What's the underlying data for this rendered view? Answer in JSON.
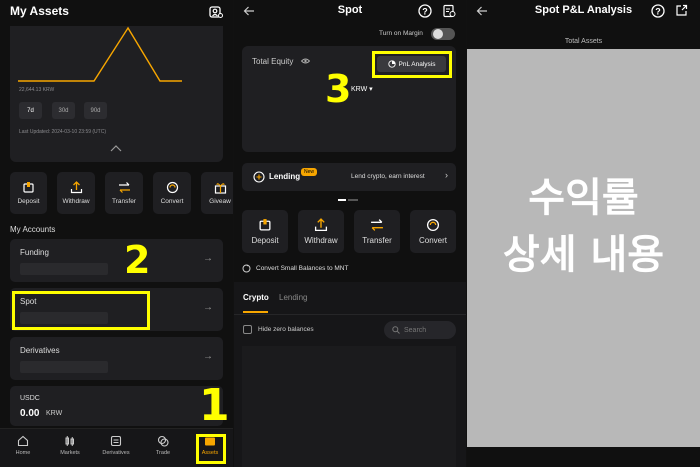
{
  "panel1": {
    "title": "My Assets",
    "chart_value": "22,644.13 KRW",
    "ranges": [
      "7d",
      "30d",
      "90d"
    ],
    "active_range": "7d",
    "last_updated": "Last Updated: 2024-03-10 23:59 (UTC)",
    "actions": [
      "Deposit",
      "Withdraw",
      "Transfer",
      "Convert",
      "Giveaw"
    ],
    "my_accounts_label": "My Accounts",
    "accounts": [
      {
        "name": "Funding"
      },
      {
        "name": "Spot"
      },
      {
        "name": "Derivatives"
      }
    ],
    "usdc": {
      "name": "USDC",
      "amount": "0.00",
      "unit": "KRW"
    },
    "nav": [
      "Home",
      "Markets",
      "Derivatives",
      "Trade",
      "Assets"
    ],
    "annotations": {
      "n1": "1",
      "n2": "2"
    }
  },
  "panel2": {
    "title": "Spot",
    "margin_label": "Turn on Margin",
    "total_equity_label": "Total Equity",
    "pnl_button": "PnL Analysis",
    "currency": "KRW",
    "lending_label": "Lending",
    "lending_badge": "New",
    "lending_desc": "Lend crypto, earn interest",
    "actions": [
      "Deposit",
      "Withdraw",
      "Transfer",
      "Convert"
    ],
    "convert_small": "Convert Small Balances to MNT",
    "tabs": [
      "Crypto",
      "Lending"
    ],
    "active_tab": "Crypto",
    "hide_zero": "Hide zero balances",
    "search_placeholder": "Search",
    "annotations": {
      "n3": "3"
    }
  },
  "panel3": {
    "title": "Spot P&L Analysis",
    "total_assets_label": "Total Assets",
    "overlay_line1": "수익률",
    "overlay_line2": "상세 내용"
  },
  "colors": {
    "accent": "#f7a600",
    "highlight": "#ffff00",
    "background": "#101010",
    "card": "#1f1f22"
  }
}
